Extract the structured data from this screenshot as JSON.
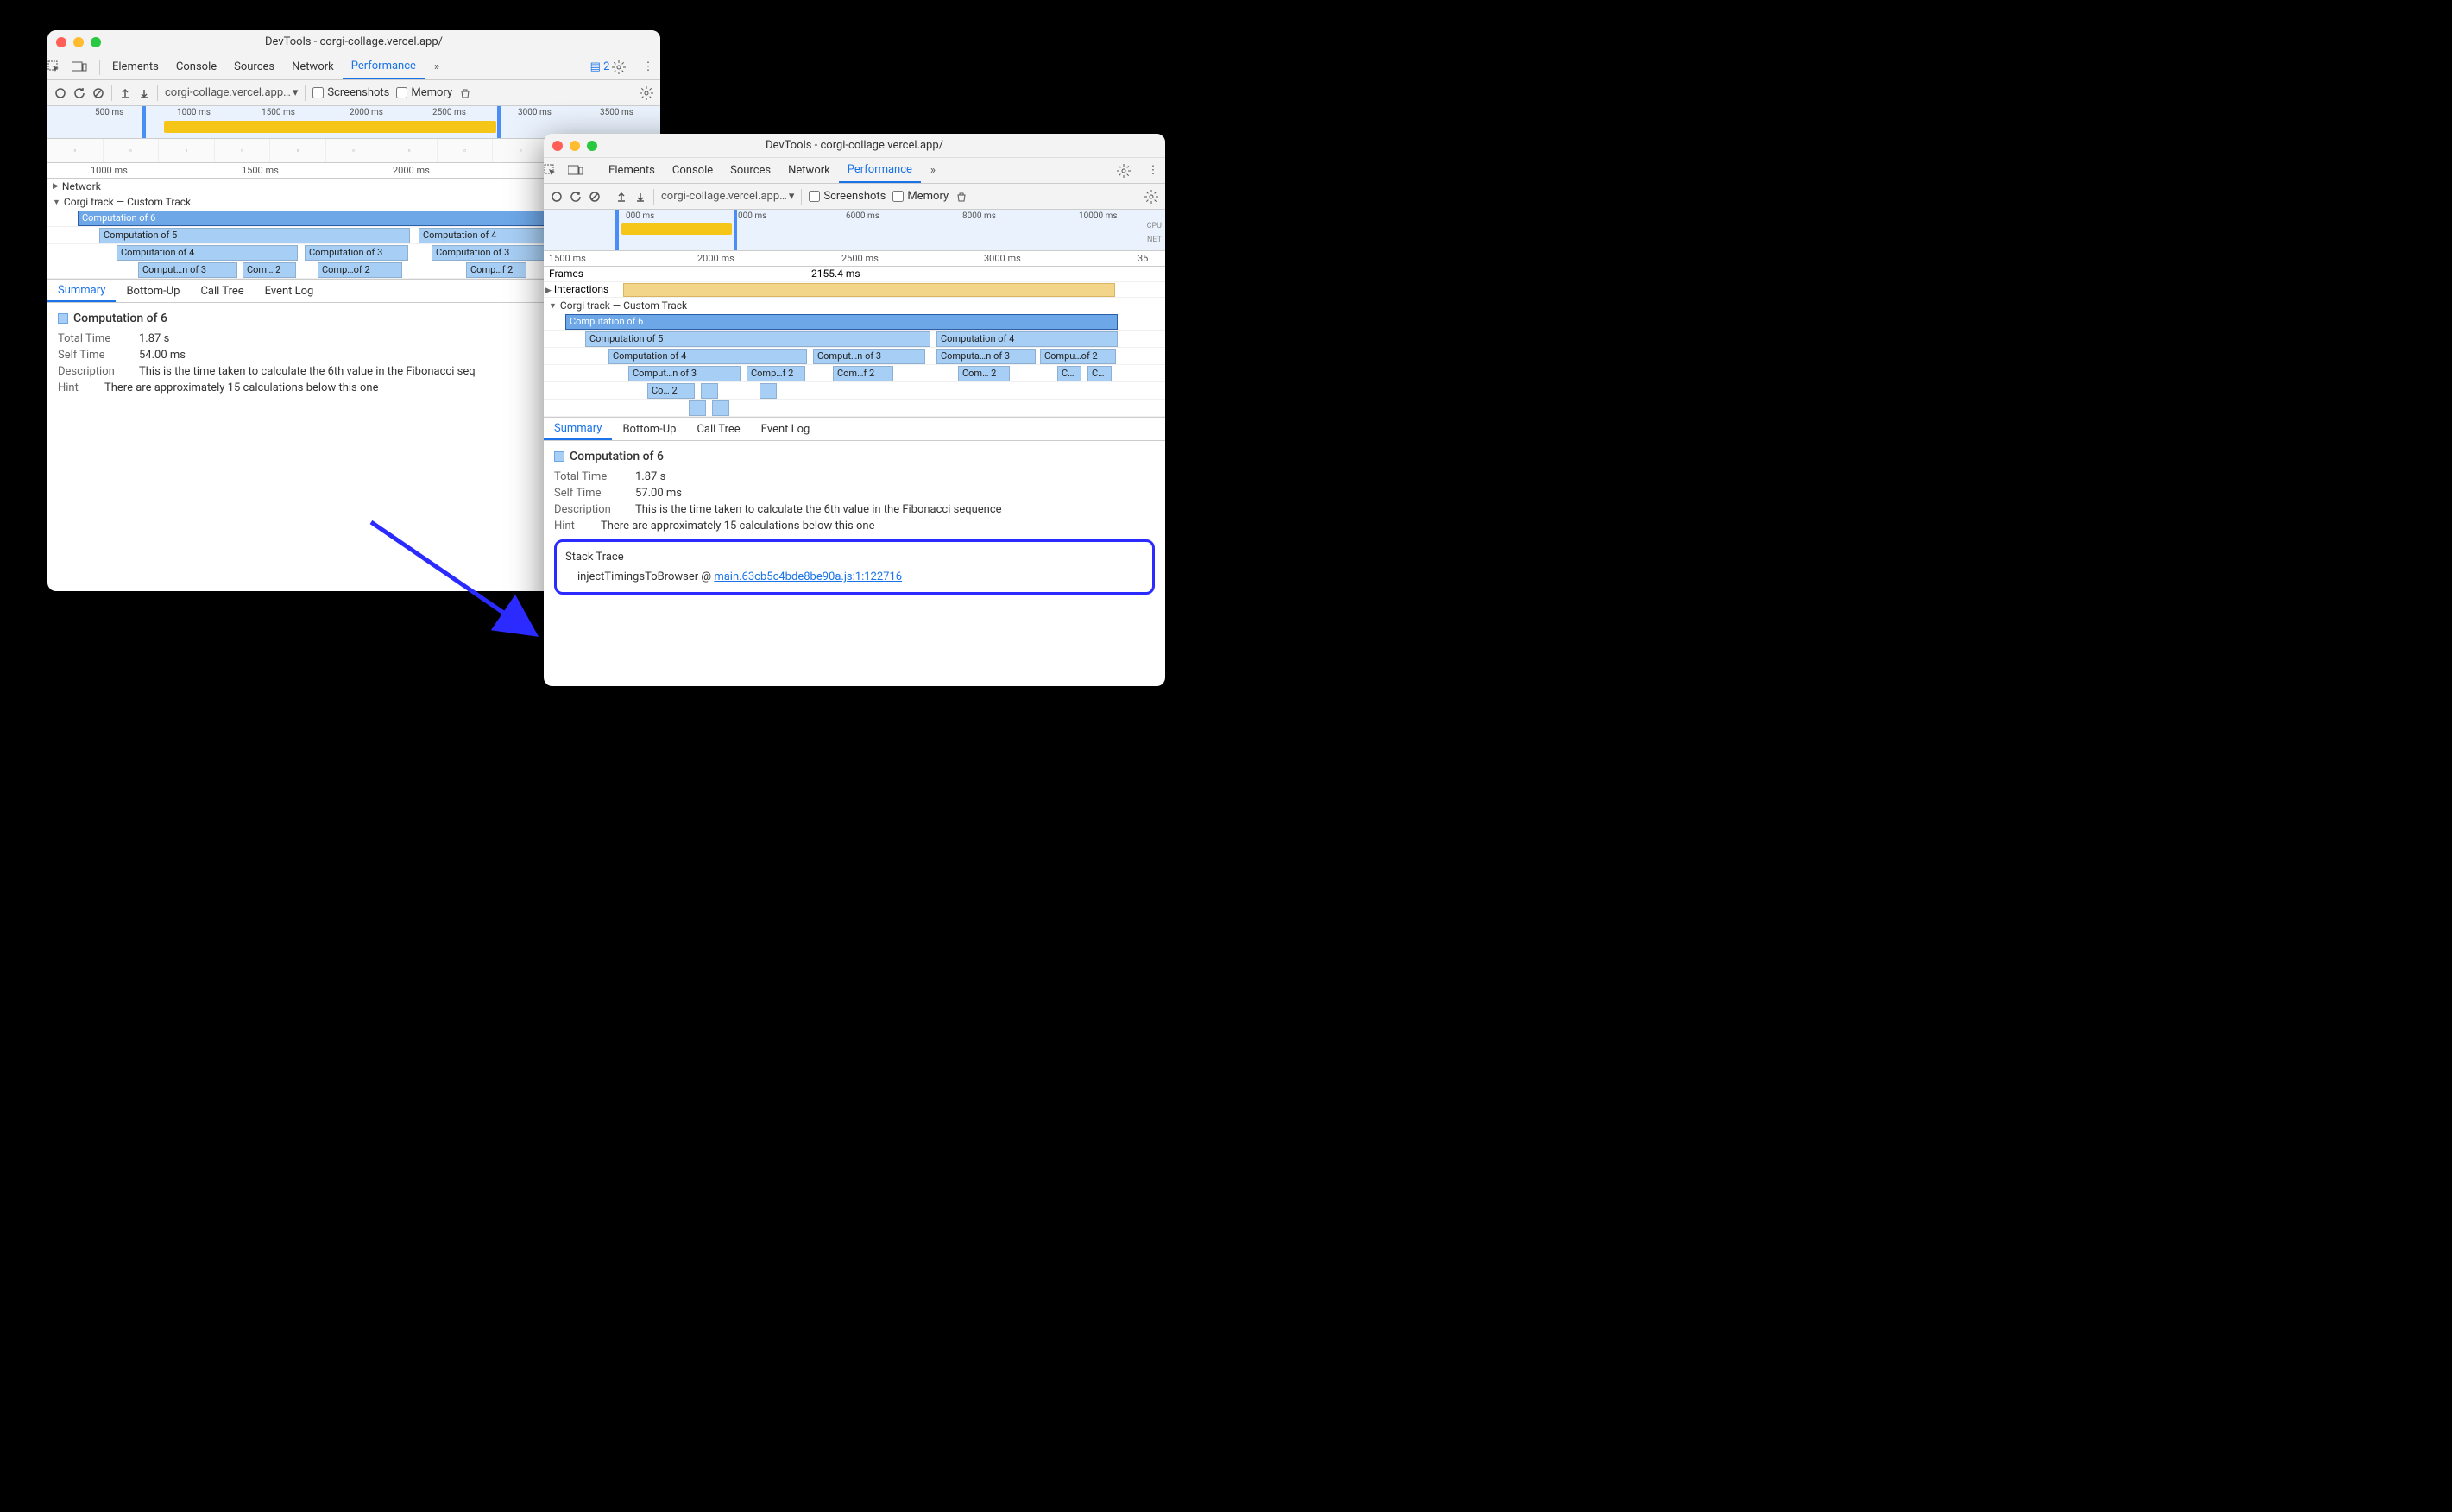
{
  "win1": {
    "title": "DevTools - corgi-collage.vercel.app/",
    "tabs": [
      "Elements",
      "Console",
      "Sources",
      "Network",
      "Performance"
    ],
    "activeTab": "Performance",
    "moreTabsGlyph": "»",
    "badgeCount": "2",
    "toolbar": {
      "url": "corgi-collage.vercel.app…",
      "chk1": "Screenshots",
      "chk2": "Memory"
    },
    "overviewTicks": [
      "500 ms",
      "1000 ms",
      "1500 ms",
      "2000 ms",
      "2500 ms",
      "3000 ms",
      "3500 ms"
    ],
    "rulerTicks": [
      "1000 ms",
      "1500 ms",
      "2000 ms"
    ],
    "tracks": {
      "network": "Network",
      "custom": "Corgi track — Custom Track"
    },
    "flame": {
      "r0": [
        "Computation of 6"
      ],
      "r1": [
        "Computation of 5",
        "Computation of 4"
      ],
      "r2": [
        "Computation of 4",
        "Computation of 3",
        "Computation of 3"
      ],
      "r3": [
        "Comput…n of 3",
        "Com… 2",
        "Comp…of 2",
        "Comp…f 2"
      ]
    },
    "bottomTabs": [
      "Summary",
      "Bottom-Up",
      "Call Tree",
      "Event Log"
    ],
    "activeBottomTab": "Summary",
    "summary": {
      "title": "Computation of 6",
      "totalTimeLbl": "Total Time",
      "totalTime": "1.87 s",
      "selfTimeLbl": "Self Time",
      "selfTime": "54.00 ms",
      "descLbl": "Description",
      "desc": "This is the time taken to calculate the 6th value in the Fibonacci seq",
      "hintLbl": "Hint",
      "hint": "There are approximately 15 calculations below this one"
    }
  },
  "win2": {
    "title": "DevTools - corgi-collage.vercel.app/",
    "tabs": [
      "Elements",
      "Console",
      "Sources",
      "Network",
      "Performance"
    ],
    "activeTab": "Performance",
    "moreTabsGlyph": "»",
    "toolbar": {
      "url": "corgi-collage.vercel.app…",
      "chk1": "Screenshots",
      "chk2": "Memory"
    },
    "overviewTicks": [
      "000 ms",
      "000 ms",
      "6000 ms",
      "8000 ms",
      "10000 ms"
    ],
    "overviewLabels": {
      "cpu": "CPU",
      "net": "NET"
    },
    "rulerTicks": [
      "1500 ms",
      "2000 ms",
      "2500 ms",
      "3000 ms",
      "35"
    ],
    "tracks": {
      "frames": "Frames",
      "framesVal": "2155.4 ms",
      "interactions": "Interactions",
      "custom": "Corgi track — Custom Track"
    },
    "flame": {
      "r0": [
        "Computation of 6"
      ],
      "r1": [
        "Computation of 5",
        "Computation of 4"
      ],
      "r2": [
        "Computation of 4",
        "Comput…n of 3",
        "Computa…n of 3",
        "Compu…of 2"
      ],
      "r3": [
        "Comput…n of 3",
        "Comp…f 2",
        "Com…f 2",
        "Com… 2",
        "C…",
        "C…"
      ],
      "r4": [
        "Co… 2"
      ]
    },
    "bottomTabs": [
      "Summary",
      "Bottom-Up",
      "Call Tree",
      "Event Log"
    ],
    "activeBottomTab": "Summary",
    "summary": {
      "title": "Computation of 6",
      "totalTimeLbl": "Total Time",
      "totalTime": "1.87 s",
      "selfTimeLbl": "Self Time",
      "selfTime": "57.00 ms",
      "descLbl": "Description",
      "desc": "This is the time taken to calculate the 6th value in the Fibonacci sequence",
      "hintLbl": "Hint",
      "hint": "There are approximately 15 calculations below this one",
      "stackTraceLbl": "Stack Trace",
      "stackFn": "injectTimingsToBrowser @ ",
      "stackLink": "main.63cb5c4bde8be90a.js:1:122716"
    }
  }
}
